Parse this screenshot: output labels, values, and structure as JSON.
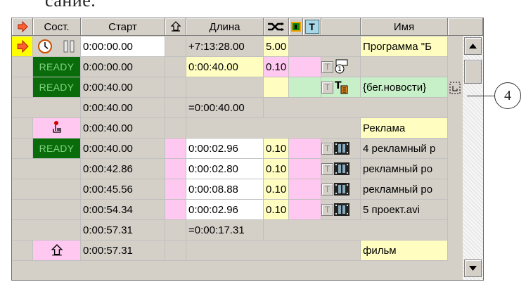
{
  "caption_fragment": "сание.",
  "header": {
    "status_label": "Сост.",
    "start_label": "Старт",
    "length_label": "Длина",
    "t_label": "T",
    "name_label": "Имя"
  },
  "rows": [
    {
      "start": "0:00:00.00",
      "length": "+7:13:28.00",
      "speed": "5.00",
      "name": "Программа \"Б"
    },
    {
      "status": "READY",
      "start": "0:00:00.00",
      "length": "0:00:40.00",
      "speed": "0.10",
      "t": "T",
      "name": ""
    },
    {
      "status": "READY",
      "start": "0:00:40.00",
      "length": "",
      "speed": "",
      "t": "T",
      "name": "{бег.новости}"
    },
    {
      "start": "0:00:40.00",
      "length": "=0:00:40.00"
    },
    {
      "start": "0:00:40.00",
      "name": "Реклама"
    },
    {
      "status": "READY",
      "start": "0:00:40.00",
      "length": "0:00:02.96",
      "speed": "0.10",
      "t": "T",
      "name": "4 рекламный р"
    },
    {
      "start": "0:00:42.86",
      "length": "0:00:02.80",
      "speed": "0.10",
      "t": "T",
      "name": "рекламный ро"
    },
    {
      "start": "0:00:45.56",
      "length": "0:00:08.88",
      "speed": "0.10",
      "t": "T",
      "name": "рекламный ро"
    },
    {
      "start": "0:00:54.34",
      "length": "0:00:02.96",
      "speed": "0.10",
      "t": "T",
      "name": "5 проект.avi"
    },
    {
      "start": "0:00:57.31",
      "length": "=0:00:17.31"
    },
    {
      "start": "0:00:57.31",
      "name": "фильм"
    }
  ],
  "callout_number": "4",
  "colors": {
    "ready_bg": "#0a6b0a",
    "ready_text": "#7fd47f",
    "yellow": "#fffec0",
    "pink": "#ffc8f0",
    "green": "#c8f0c8"
  }
}
